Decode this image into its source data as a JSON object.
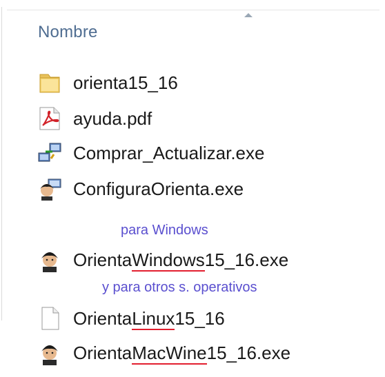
{
  "header": {
    "column_name": "Nombre",
    "sort_icon": "sort-ascending-icon"
  },
  "files": [
    {
      "name": "orienta15_16",
      "icon": "folder-icon",
      "type": "folder"
    },
    {
      "name": "ayuda.pdf",
      "icon": "pdf-icon",
      "type": "pdf"
    },
    {
      "name": "Comprar_Actualizar.exe",
      "icon": "network-computer-icon",
      "type": "exe"
    },
    {
      "name": "ConfiguraOrienta.exe",
      "icon": "character-computer-icon",
      "type": "exe"
    }
  ],
  "note_windows": "para Windows",
  "windows_file": {
    "prefix": "Orienta",
    "highlight": "Windows",
    "suffix": "15_16.exe",
    "icon": "character-icon"
  },
  "note_others": "y para otros s. operativos",
  "linux_file": {
    "prefix": "Orienta",
    "highlight": "Linux",
    "suffix": "15_16",
    "icon": "blank-file-icon"
  },
  "mac_file": {
    "prefix": "Orienta",
    "highlight": "MacWine",
    "suffix": "15_16.exe",
    "icon": "character-icon"
  },
  "colors": {
    "header_text": "#4f6d91",
    "note_text": "#5a4fcf",
    "underline": "#e21e2e"
  }
}
